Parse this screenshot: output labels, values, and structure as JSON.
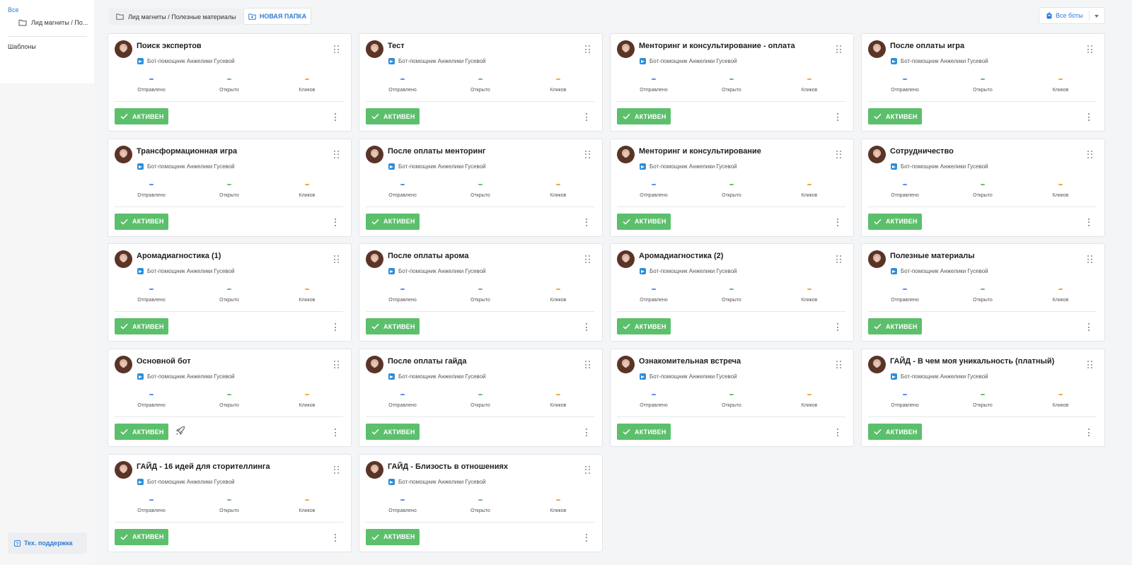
{
  "sidebar": {
    "all_label": "Все",
    "folder_label": "Лид магниты / По...",
    "templates_label": "Шаблоны",
    "support_label": "Тех. поддержка"
  },
  "topbar": {
    "breadcrumb": "Лид магниты / Полезные материалы",
    "new_folder_label": "НОВАЯ ПАПКА",
    "bots_select_value": "Все боты"
  },
  "card_common": {
    "bot_name": "Бот-помощник Анжелики Гусевой",
    "status_label": "АКТИВЕН",
    "stats": [
      {
        "label": "Отправлено",
        "value": "—",
        "color": "#5b8def"
      },
      {
        "label": "Открыто",
        "value": "—",
        "color": "#6cc070"
      },
      {
        "label": "Кликов",
        "value": "—",
        "color": "#f0a742"
      }
    ],
    "status_color": "#5cbf6c",
    "accent_color": "#2f7bd6"
  },
  "cards": [
    {
      "title": "Поиск экспертов"
    },
    {
      "title": "Тест"
    },
    {
      "title": "Менторинг и консультирование - оплата"
    },
    {
      "title": "После оплаты игра"
    },
    {
      "title": "Трансформационная игра"
    },
    {
      "title": "После оплаты менторинг"
    },
    {
      "title": "Менторинг и консультирование"
    },
    {
      "title": "Сотрудничество"
    },
    {
      "title": "Аромадиагностика (1)"
    },
    {
      "title": "После оплаты арома"
    },
    {
      "title": "Аромадиагностика (2)"
    },
    {
      "title": "Полезные материалы"
    },
    {
      "title": "Основной бот",
      "rocket": true
    },
    {
      "title": "После оплаты гайда"
    },
    {
      "title": "Ознакомительная встреча"
    },
    {
      "title": "ГАЙД - В чем моя уникальность (платный)"
    },
    {
      "title": "ГАЙД - 16 идей для сторителлинга"
    },
    {
      "title": "ГАЙД - Близость в отношениях"
    }
  ]
}
